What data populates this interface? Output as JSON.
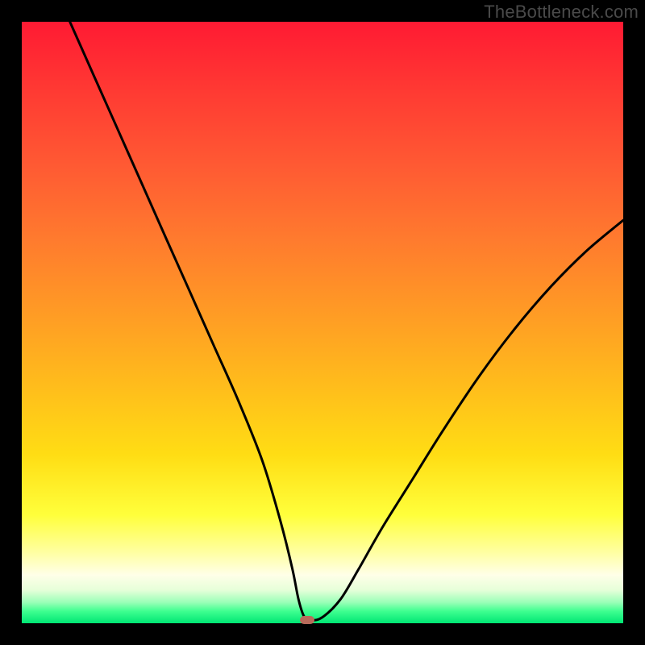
{
  "watermark": "TheBottleneck.com",
  "chart_data": {
    "type": "line",
    "title": "",
    "xlabel": "",
    "ylabel": "",
    "xlim": [
      0,
      100
    ],
    "ylim": [
      0,
      100
    ],
    "grid": false,
    "legend": false,
    "series": [
      {
        "name": "curve",
        "x": [
          8,
          12,
          16,
          20,
          24,
          28,
          32,
          36,
          40,
          43,
          45,
          46,
          47,
          48,
          50,
          53,
          56,
          60,
          65,
          70,
          76,
          82,
          88,
          94,
          100
        ],
        "y": [
          100,
          91,
          82,
          73,
          64,
          55,
          46,
          37,
          27,
          17,
          9,
          4,
          1,
          0.5,
          1,
          4,
          9,
          16,
          24,
          32,
          41,
          49,
          56,
          62,
          67
        ]
      }
    ],
    "marker": {
      "x": 47.5,
      "y": 0.5
    },
    "background_gradient": {
      "top": "#ff1a33",
      "mid": "#ffdd14",
      "bottom": "#00e673"
    }
  }
}
